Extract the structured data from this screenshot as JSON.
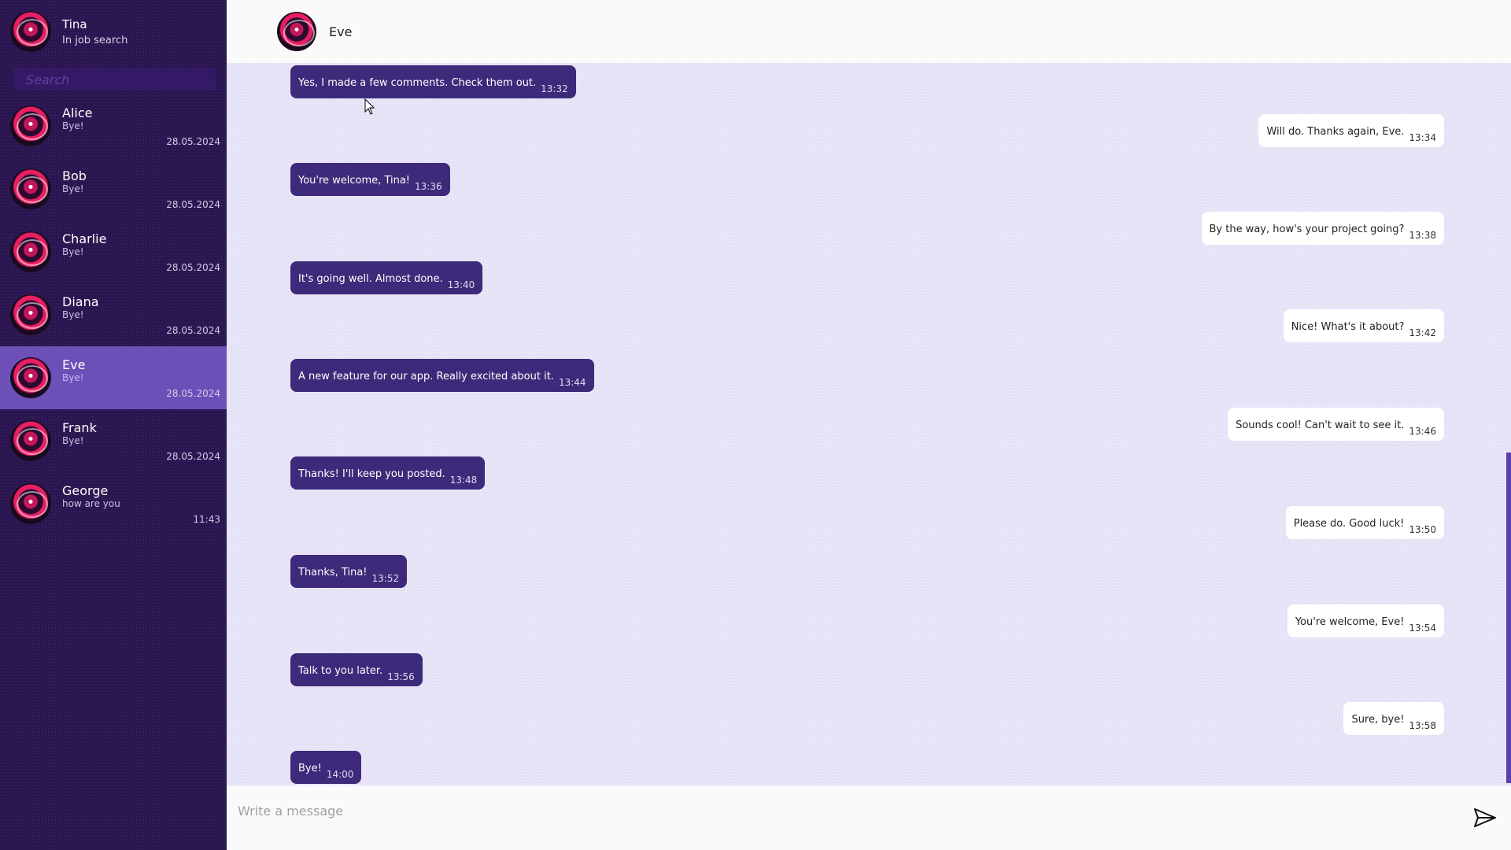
{
  "user": {
    "name": "Tina",
    "status": "In job search",
    "avatar_icon": "avatar-icon"
  },
  "search": {
    "placeholder": "Search"
  },
  "contacts": [
    {
      "name": "Alice",
      "last": "Bye!",
      "date": "28.05.2024"
    },
    {
      "name": "Bob",
      "last": "Bye!",
      "date": "28.05.2024"
    },
    {
      "name": "Charlie",
      "last": "Bye!",
      "date": "28.05.2024"
    },
    {
      "name": "Diana",
      "last": "Bye!",
      "date": "28.05.2024"
    },
    {
      "name": "Eve",
      "last": "Bye!",
      "date": "28.05.2024"
    },
    {
      "name": "Frank",
      "last": "Bye!",
      "date": "28.05.2024"
    },
    {
      "name": "George",
      "last": "how are you",
      "date": "11:43"
    }
  ],
  "chat": {
    "title": "Eve",
    "messages": [
      {
        "dir": "in",
        "text": "Yes, I made a few comments. Check them out.",
        "time": "13:32"
      },
      {
        "dir": "out",
        "text": "Will do. Thanks again, Eve.",
        "time": "13:34"
      },
      {
        "dir": "in",
        "text": "You're welcome, Tina!",
        "time": "13:36"
      },
      {
        "dir": "out",
        "text": "By the way, how's your project going?",
        "time": "13:38"
      },
      {
        "dir": "in",
        "text": "It's going well. Almost done.",
        "time": "13:40"
      },
      {
        "dir": "out",
        "text": "Nice! What's it about?",
        "time": "13:42"
      },
      {
        "dir": "in",
        "text": "A new feature for our app. Really excited about it.",
        "time": "13:44"
      },
      {
        "dir": "out",
        "text": "Sounds cool! Can't wait to see it.",
        "time": "13:46"
      },
      {
        "dir": "in",
        "text": "Thanks! I'll keep you posted.",
        "time": "13:48"
      },
      {
        "dir": "out",
        "text": "Please do. Good luck!",
        "time": "13:50"
      },
      {
        "dir": "in",
        "text": "Thanks, Tina!",
        "time": "13:52"
      },
      {
        "dir": "out",
        "text": "You're welcome, Eve!",
        "time": "13:54"
      },
      {
        "dir": "in",
        "text": "Talk to you later.",
        "time": "13:56"
      },
      {
        "dir": "out",
        "text": "Sure, bye!",
        "time": "13:58"
      },
      {
        "dir": "in",
        "text": "Bye!",
        "time": "14:00"
      }
    ]
  },
  "composer": {
    "placeholder": "Write a message",
    "value": ""
  },
  "colors": {
    "sidebar": "#2a1550",
    "active": "#6d4fb8",
    "incoming": "#3d2a7a",
    "outgoing": "#ffffff",
    "chat_bg": "#e8e5f8"
  }
}
